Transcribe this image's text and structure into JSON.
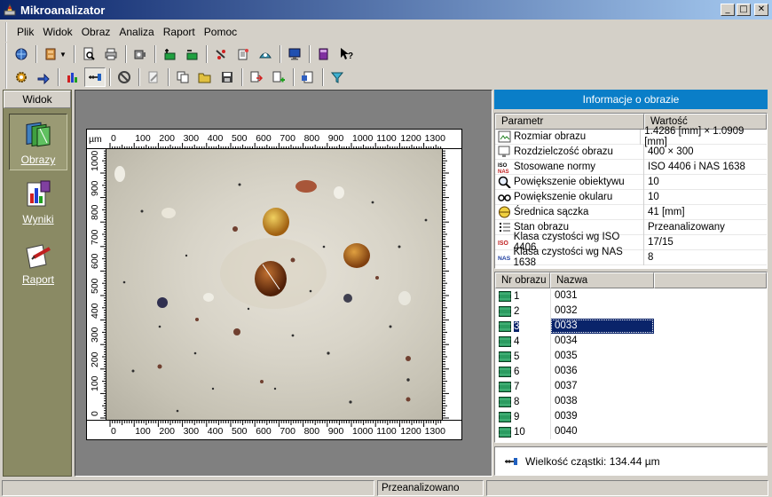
{
  "window": {
    "title": "Mikroanalizator"
  },
  "menu": [
    "Plik",
    "Widok",
    "Obraz",
    "Analiza",
    "Raport",
    "Pomoc"
  ],
  "sidebar": {
    "header": "Widok",
    "items": [
      {
        "label": "Obrazy",
        "icon": "images-stack-icon",
        "active": true
      },
      {
        "label": "Wyniki",
        "icon": "results-chart-icon",
        "active": false
      },
      {
        "label": "Raport",
        "icon": "report-pen-icon",
        "active": false
      }
    ]
  },
  "ruler": {
    "unit": "µm",
    "x_ticks": [
      "0",
      "100",
      "200",
      "300",
      "400",
      "500",
      "600",
      "700",
      "800",
      "900",
      "1000",
      "1100",
      "1200",
      "1300"
    ],
    "y_ticks": [
      "0",
      "100",
      "200",
      "300",
      "400",
      "500",
      "600",
      "700",
      "800",
      "900",
      "1000"
    ]
  },
  "info": {
    "header": "Informacje o obrazie",
    "col_param": "Parametr",
    "col_value": "Wartość",
    "rows": [
      {
        "param": "Rozmiar obrazu",
        "value": "1.4286 [mm] × 1.0909 [mm]",
        "icon": "image-size-icon"
      },
      {
        "param": "Rozdzielczość obrazu",
        "value": "400 × 300",
        "icon": "monitor-resolution-icon"
      },
      {
        "param": "Stosowane normy",
        "value": "ISO 4406 i NAS 1638",
        "icon": "iso-nas-icon"
      },
      {
        "param": "Powiększenie obiektywu",
        "value": "10",
        "icon": "magnifier-icon"
      },
      {
        "param": "Powiększenie okularu",
        "value": "10",
        "icon": "eyepiece-icon"
      },
      {
        "param": "Średnica sączka",
        "value": "41 [mm]",
        "icon": "filter-diameter-icon"
      },
      {
        "param": "Stan obrazu",
        "value": "Przeanalizowany",
        "icon": "status-list-icon"
      },
      {
        "param": "Klasa czystości wg ISO 4406",
        "value": "17/15",
        "icon": "iso-icon"
      },
      {
        "param": "Klasa czystości wg NAS 1638",
        "value": "8",
        "icon": "nas-icon"
      }
    ]
  },
  "images_list": {
    "col_nr": "Nr obrazu",
    "col_name": "Nazwa",
    "rows": [
      {
        "nr": "1",
        "name": "0031"
      },
      {
        "nr": "2",
        "name": "0032"
      },
      {
        "nr": "3",
        "name": "0033",
        "selected": true
      },
      {
        "nr": "4",
        "name": "0034"
      },
      {
        "nr": "5",
        "name": "0035"
      },
      {
        "nr": "6",
        "name": "0036"
      },
      {
        "nr": "7",
        "name": "0037"
      },
      {
        "nr": "8",
        "name": "0038"
      },
      {
        "nr": "9",
        "name": "0039"
      },
      {
        "nr": "10",
        "name": "0040"
      }
    ]
  },
  "particle": {
    "label": "Wielkość cząstki:",
    "value": "134.44 µm"
  },
  "status": {
    "text": "Przeanalizowano"
  },
  "colors": {
    "sidebar": "#8a8a64",
    "info_header": "#0a7ec8",
    "selection": "#0a246a",
    "title_bar": "#0a246a"
  }
}
